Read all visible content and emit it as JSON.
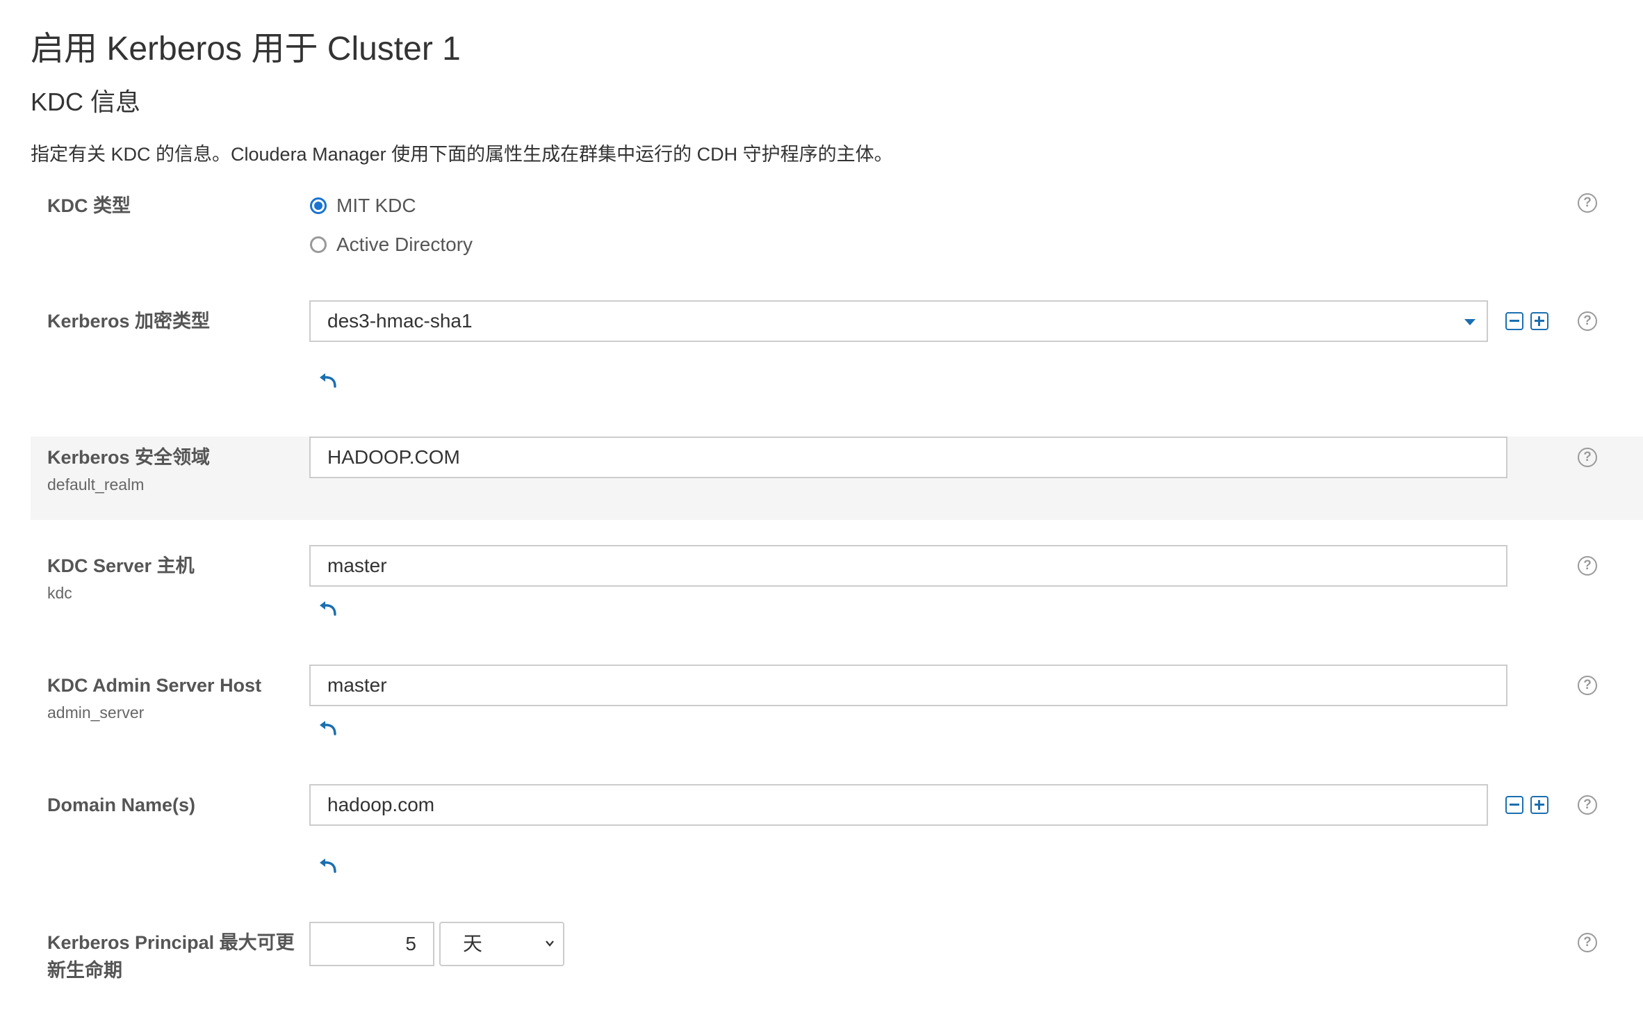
{
  "page": {
    "title": "启用 Kerberos 用于 Cluster 1",
    "section_title": "KDC 信息",
    "intro": "指定有关 KDC 的信息。Cloudera Manager 使用下面的属性生成在群集中运行的 CDH 守护程序的主体。"
  },
  "kdc_type": {
    "label": "KDC 类型",
    "options": [
      {
        "label": "MIT KDC",
        "selected": true
      },
      {
        "label": "Active Directory",
        "selected": false
      }
    ]
  },
  "encryption": {
    "label": "Kerberos 加密类型",
    "value": "des3-hmac-sha1"
  },
  "realm": {
    "label": "Kerberos 安全领域",
    "key": "default_realm",
    "value": "HADOOP.COM"
  },
  "kdc_server": {
    "label": "KDC Server 主机",
    "key": "kdc",
    "value": "master"
  },
  "admin_server": {
    "label": "KDC Admin Server Host",
    "key": "admin_server",
    "value": "master"
  },
  "domain": {
    "label": "Domain Name(s)",
    "value": "hadoop.com"
  },
  "principal": {
    "label": "Kerberos Principal 最大可更新生命期",
    "value": "5",
    "unit": "天"
  },
  "icons": {
    "help": "help-circle-icon",
    "undo": "undo-arrow-icon",
    "remove": "minus-box-icon",
    "add": "plus-box-icon",
    "caret": "caret-down-icon"
  },
  "colors": {
    "accent": "#1a6fb0",
    "radio_selected": "#1a73d1",
    "highlight_row": "#f5f5f5",
    "border": "#cccccc"
  },
  "help_glyph": "?"
}
